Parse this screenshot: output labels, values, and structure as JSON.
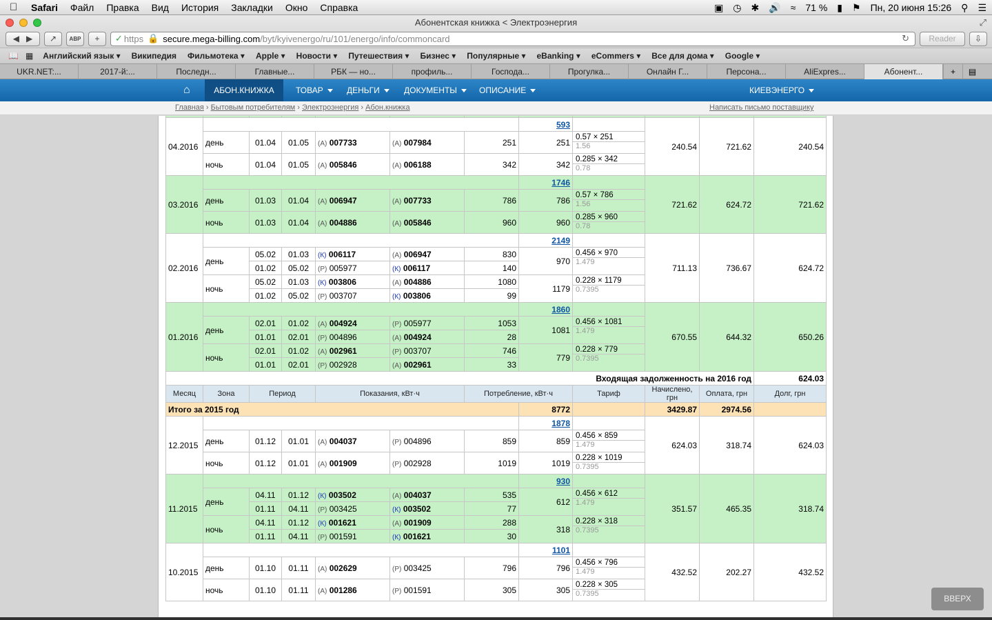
{
  "os_menu": {
    "app": "Safari",
    "items": [
      "Файл",
      "Правка",
      "Вид",
      "История",
      "Закладки",
      "Окно",
      "Справка"
    ],
    "battery": "71 %",
    "datetime": "Пн, 20 июня  15:26"
  },
  "window": {
    "title": "Абонентская книжка < Электроэнергия"
  },
  "address": {
    "scheme": "https",
    "host": "secure.mega-billing.com",
    "path": "/byt/kyivenergo/ru/101/energo/info/commoncard",
    "reader": "Reader"
  },
  "bookmarks": [
    "Английский язык",
    "Википедия",
    "Фильмотека",
    "Apple",
    "Новости",
    "Путешествия",
    "Бизнес",
    "Популярные",
    "eBanking",
    "eCommers",
    "Все для дома",
    "Google"
  ],
  "tabs": [
    "UKR.NET:...",
    "2017-й:...",
    "Последн...",
    "Главные...",
    "РБК — но...",
    "профиль...",
    "Господа...",
    "Прогулка...",
    "Онлайн Г...",
    "Персона...",
    "AliExpres...",
    "Абонент..."
  ],
  "site_nav": {
    "items": [
      "АБОН.КНИЖКА",
      "ТОВАР",
      "ДЕНЬГИ",
      "ДОКУМЕНТЫ",
      "ОПИСАНИЕ"
    ],
    "region": "КИЕВЭНЕРГО"
  },
  "breadcrumb": {
    "items": [
      "Главная",
      "Бытовым потребителям",
      "Электроэнергия",
      "Абон.книжка"
    ],
    "write_link": "Написать письмо поставщику"
  },
  "table": {
    "months": [
      {
        "month": "04.2016",
        "total": "593",
        "charged": "240.54",
        "paid": "721.62",
        "debt": "240.54",
        "green": false,
        "zones": [
          {
            "zone": "день",
            "rows": [
              {
                "from": "01.04",
                "to": "01.05",
                "sl": "(А)",
                "sv": "007733",
                "sb": true,
                "el": "(А)",
                "ev": "007984",
                "eb": true,
                "cons": "251"
              }
            ],
            "zone_total": "251",
            "tariff": "0.57 × 251",
            "tariff_sub": "1.56"
          },
          {
            "zone": "ночь",
            "rows": [
              {
                "from": "01.04",
                "to": "01.05",
                "sl": "(А)",
                "sv": "005846",
                "sb": true,
                "el": "(А)",
                "ev": "006188",
                "eb": true,
                "cons": "342"
              }
            ],
            "zone_total": "342",
            "tariff": "0.285 × 342",
            "tariff_sub": "0.78"
          }
        ]
      },
      {
        "month": "03.2016",
        "total": "1746",
        "charged": "721.62",
        "paid": "624.72",
        "debt": "721.62",
        "green": true,
        "zones": [
          {
            "zone": "день",
            "rows": [
              {
                "from": "01.03",
                "to": "01.04",
                "sl": "(А)",
                "sv": "006947",
                "sb": true,
                "el": "(А)",
                "ev": "007733",
                "eb": true,
                "cons": "786"
              }
            ],
            "zone_total": "786",
            "tariff": "0.57 × 786",
            "tariff_sub": "1.56"
          },
          {
            "zone": "ночь",
            "rows": [
              {
                "from": "01.03",
                "to": "01.04",
                "sl": "(А)",
                "sv": "004886",
                "sb": true,
                "el": "(А)",
                "ev": "005846",
                "eb": true,
                "cons": "960"
              }
            ],
            "zone_total": "960",
            "tariff": "0.285 × 960",
            "tariff_sub": "0.78"
          }
        ]
      },
      {
        "month": "02.2016",
        "total": "2149",
        "charged": "711.13",
        "paid": "736.67",
        "debt": "624.72",
        "green": false,
        "zones": [
          {
            "zone": "день",
            "rows": [
              {
                "from": "05.02",
                "to": "01.03",
                "sl": "(К)",
                "sv": "006117",
                "sb": true,
                "el": "(А)",
                "ev": "006947",
                "eb": true,
                "cons": "830"
              },
              {
                "from": "01.02",
                "to": "05.02",
                "sl": "(Р)",
                "sv": "005977",
                "sb": false,
                "el": "(К)",
                "ev": "006117",
                "eb": true,
                "cons": "140"
              }
            ],
            "zone_total": "970",
            "tariff": "0.456 × 970",
            "tariff_sub": "1.479"
          },
          {
            "zone": "ночь",
            "rows": [
              {
                "from": "05.02",
                "to": "01.03",
                "sl": "(К)",
                "sv": "003806",
                "sb": true,
                "el": "(А)",
                "ev": "004886",
                "eb": true,
                "cons": "1080"
              },
              {
                "from": "01.02",
                "to": "05.02",
                "sl": "(Р)",
                "sv": "003707",
                "sb": false,
                "el": "(К)",
                "ev": "003806",
                "eb": true,
                "cons": "99"
              }
            ],
            "zone_total": "1179",
            "tariff": "0.228 × 1179",
            "tariff_sub": "0.7395"
          }
        ]
      },
      {
        "month": "01.2016",
        "total": "1860",
        "charged": "670.55",
        "paid": "644.32",
        "debt": "650.26",
        "green": true,
        "zones": [
          {
            "zone": "день",
            "rows": [
              {
                "from": "02.01",
                "to": "01.02",
                "sl": "(А)",
                "sv": "004924",
                "sb": true,
                "el": "(Р)",
                "ev": "005977",
                "eb": false,
                "cons": "1053"
              },
              {
                "from": "01.01",
                "to": "02.01",
                "sl": "(Р)",
                "sv": "004896",
                "sb": false,
                "el": "(А)",
                "ev": "004924",
                "eb": true,
                "cons": "28"
              }
            ],
            "zone_total": "1081",
            "tariff": "0.456 × 1081",
            "tariff_sub": "1.479"
          },
          {
            "zone": "ночь",
            "rows": [
              {
                "from": "02.01",
                "to": "01.02",
                "sl": "(А)",
                "sv": "002961",
                "sb": true,
                "el": "(Р)",
                "ev": "003707",
                "eb": false,
                "cons": "746"
              },
              {
                "from": "01.01",
                "to": "02.01",
                "sl": "(Р)",
                "sv": "002928",
                "sb": false,
                "el": "(А)",
                "ev": "002961",
                "eb": true,
                "cons": "33"
              }
            ],
            "zone_total": "779",
            "tariff": "0.228 × 779",
            "tariff_sub": "0.7395"
          }
        ]
      }
    ],
    "incoming_debt": {
      "label": "Входящая задолженность на 2016 год",
      "value": "624.03"
    },
    "headers": [
      "Месяц",
      "Зона",
      "Период",
      "Показания, кВт·ч",
      "Потребление, кВт·ч",
      "Тариф",
      "Начислено, грн",
      "Оплата, грн",
      "Долг, грн"
    ],
    "year_total": {
      "label": "Итого за 2015 год",
      "consumption": "8772",
      "charged": "3429.87",
      "paid": "2974.56"
    },
    "months_2015": [
      {
        "month": "12.2015",
        "total": "1878",
        "charged": "624.03",
        "paid": "318.74",
        "debt": "624.03",
        "green": false,
        "zones": [
          {
            "zone": "день",
            "rows": [
              {
                "from": "01.12",
                "to": "01.01",
                "sl": "(А)",
                "sv": "004037",
                "sb": true,
                "el": "(Р)",
                "ev": "004896",
                "eb": false,
                "cons": "859"
              }
            ],
            "zone_total": "859",
            "tariff": "0.456 × 859",
            "tariff_sub": "1.479"
          },
          {
            "zone": "ночь",
            "rows": [
              {
                "from": "01.12",
                "to": "01.01",
                "sl": "(А)",
                "sv": "001909",
                "sb": true,
                "el": "(Р)",
                "ev": "002928",
                "eb": false,
                "cons": "1019"
              }
            ],
            "zone_total": "1019",
            "tariff": "0.228 × 1019",
            "tariff_sub": "0.7395"
          }
        ]
      },
      {
        "month": "11.2015",
        "total": "930",
        "charged": "351.57",
        "paid": "465.35",
        "debt": "318.74",
        "green": true,
        "zones": [
          {
            "zone": "день",
            "rows": [
              {
                "from": "04.11",
                "to": "01.12",
                "sl": "(К)",
                "sv": "003502",
                "sb": true,
                "el": "(А)",
                "ev": "004037",
                "eb": true,
                "cons": "535"
              },
              {
                "from": "01.11",
                "to": "04.11",
                "sl": "(Р)",
                "sv": "003425",
                "sb": false,
                "el": "(К)",
                "ev": "003502",
                "eb": true,
                "cons": "77"
              }
            ],
            "zone_total": "612",
            "tariff": "0.456 × 612",
            "tariff_sub": "1.479"
          },
          {
            "zone": "ночь",
            "rows": [
              {
                "from": "04.11",
                "to": "01.12",
                "sl": "(К)",
                "sv": "001621",
                "sb": true,
                "el": "(А)",
                "ev": "001909",
                "eb": true,
                "cons": "288"
              },
              {
                "from": "01.11",
                "to": "04.11",
                "sl": "(Р)",
                "sv": "001591",
                "sb": false,
                "el": "(К)",
                "ev": "001621",
                "eb": true,
                "cons": "30"
              }
            ],
            "zone_total": "318",
            "tariff": "0.228 × 318",
            "tariff_sub": "0.7395"
          }
        ]
      },
      {
        "month": "10.2015",
        "total": "1101",
        "charged": "432.52",
        "paid": "202.27",
        "debt": "432.52",
        "green": false,
        "zones": [
          {
            "zone": "день",
            "rows": [
              {
                "from": "01.10",
                "to": "01.11",
                "sl": "(А)",
                "sv": "002629",
                "sb": true,
                "el": "(Р)",
                "ev": "003425",
                "eb": false,
                "cons": "796"
              }
            ],
            "zone_total": "796",
            "tariff": "0.456 × 796",
            "tariff_sub": "1.479"
          },
          {
            "zone": "ночь",
            "rows": [
              {
                "from": "01.10",
                "to": "01.11",
                "sl": "(А)",
                "sv": "001286",
                "sb": true,
                "el": "(Р)",
                "ev": "001591",
                "eb": false,
                "cons": "305"
              }
            ],
            "zone_total": "305",
            "tariff": "0.228 × 305",
            "tariff_sub": "0.7395"
          }
        ]
      }
    ],
    "top_cut_sub": "0.78"
  },
  "up_button": "ВВЕРХ",
  "colors": {
    "nav_blue": "#1a72b8",
    "row_green": "#c6f1c6",
    "total_orange": "#fce2b4",
    "header_blue": "#d9e6f0",
    "link": "#0d55a3"
  }
}
